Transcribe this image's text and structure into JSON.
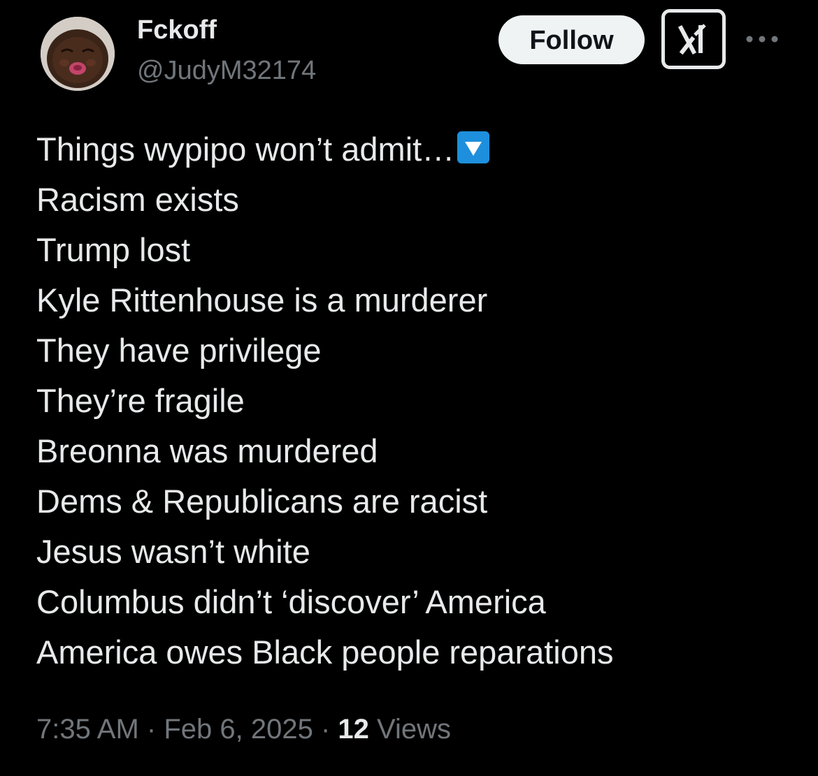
{
  "user": {
    "display_name": "Fckoff",
    "handle": "@JudyM32174",
    "avatar_icon": "baby-face-avatar"
  },
  "actions": {
    "follow_label": "Follow",
    "grok_icon": "grok-icon",
    "more_icon": "more-dots-icon"
  },
  "tweet": {
    "lines": [
      "Things wypipo won’t admit…",
      "Racism exists",
      "Trump lost",
      "Kyle Rittenhouse is a murderer",
      "They have privilege",
      "They’re fragile",
      "Breonna was murdered",
      "Dems & Republicans are racist",
      "Jesus wasn’t white",
      "Columbus didn’t ‘discover’ America",
      "America owes Black people reparations"
    ],
    "first_line_emoji": "down-button-emoji"
  },
  "meta": {
    "time": "7:35 AM",
    "separator": "·",
    "date": "Feb 6, 2025",
    "views_count": "12",
    "views_label": "Views"
  },
  "colors": {
    "background": "#000000",
    "primary_text": "#e7e9ea",
    "secondary_text": "#71767b",
    "follow_bg": "#eff3f4",
    "emoji_blue": "#1d8fdd"
  }
}
